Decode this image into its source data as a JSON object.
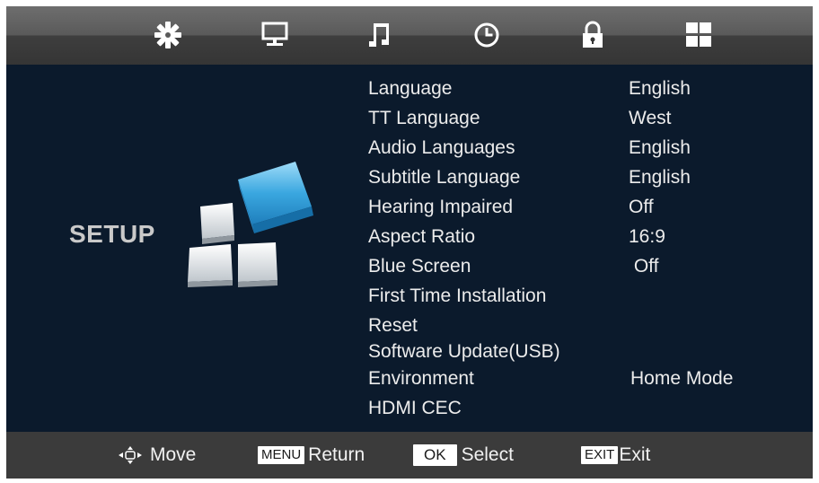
{
  "tabs": [
    {
      "icon": "picture-gear-icon"
    },
    {
      "icon": "monitor-icon"
    },
    {
      "icon": "music-note-icon"
    },
    {
      "icon": "clock-icon"
    },
    {
      "icon": "lock-icon"
    },
    {
      "icon": "setup-grid-icon"
    }
  ],
  "page": {
    "title": "SETUP"
  },
  "menu": {
    "items": [
      {
        "label": "Language",
        "value": "English"
      },
      {
        "label": "TT Language",
        "value": "West"
      },
      {
        "label": "Audio Languages",
        "value": "English"
      },
      {
        "label": "Subtitle Language",
        "value": "English"
      },
      {
        "label": "Hearing Impaired",
        "value": "Off"
      },
      {
        "label": "Aspect Ratio",
        "value": "16:9"
      },
      {
        "label": "Blue Screen",
        "value": " Off"
      },
      {
        "label": "First Time Installation",
        "value": ""
      },
      {
        "label": "Reset",
        "value": ""
      },
      {
        "label": "Software Update(USB)",
        "value": ""
      },
      {
        "label": "Environment",
        "value": "Home Mode"
      },
      {
        "label": "HDMI CEC",
        "value": ""
      }
    ]
  },
  "footer": {
    "move": {
      "label": "Move",
      "icon": "dpad-arrows-icon"
    },
    "return": {
      "key": "MENU",
      "label": "Return"
    },
    "select": {
      "key": "OK",
      "label": "Select"
    },
    "exit": {
      "key": "EXIT",
      "label": "Exit"
    }
  },
  "colors": {
    "background": "#0b1a2c",
    "topbar": "#5a5a5a",
    "bottombar": "#3b3b3b",
    "text": "#ececec",
    "title": "#c9c9c9",
    "accent_blue": "#3aa7e0"
  }
}
